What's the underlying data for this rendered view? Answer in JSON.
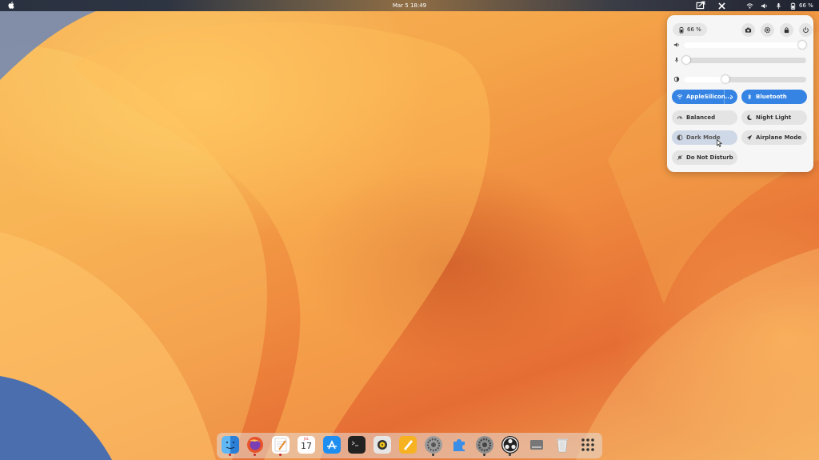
{
  "topbar": {
    "clock": "Mar 5  18:49",
    "battery": "66 %"
  },
  "quick_settings": {
    "battery": "66 %",
    "sliders": {
      "volume_level": 0.97,
      "microphone_level": 0.02,
      "brightness_level": 0.34
    },
    "tiles": {
      "wifi": "AppleSilicon...",
      "bluetooth": "Bluetooth",
      "power_mode": "Balanced",
      "night_light": "Night Light",
      "dark_mode": "Dark Mode",
      "airplane_mode": "Airplane Mode",
      "do_not_disturb": "Do Not Disturb"
    }
  },
  "dock": {
    "calendar_day": "17",
    "calendar_month": "JUL"
  },
  "colors": {
    "accent": "#3584e4",
    "panel_bg": "#f6f6f6",
    "tile_bg": "#e4e4e4"
  },
  "icons": [
    "apple-logo",
    "screenshot-icon",
    "close-icon",
    "wifi-icon",
    "volume-icon",
    "microphone-icon",
    "battery-icon",
    "camera-icon",
    "gear-icon",
    "lock-icon",
    "power-icon",
    "brightness-icon",
    "bluetooth-icon",
    "balanced-icon",
    "moon-icon",
    "dark-mode-icon",
    "airplane-icon",
    "bell-icon"
  ]
}
